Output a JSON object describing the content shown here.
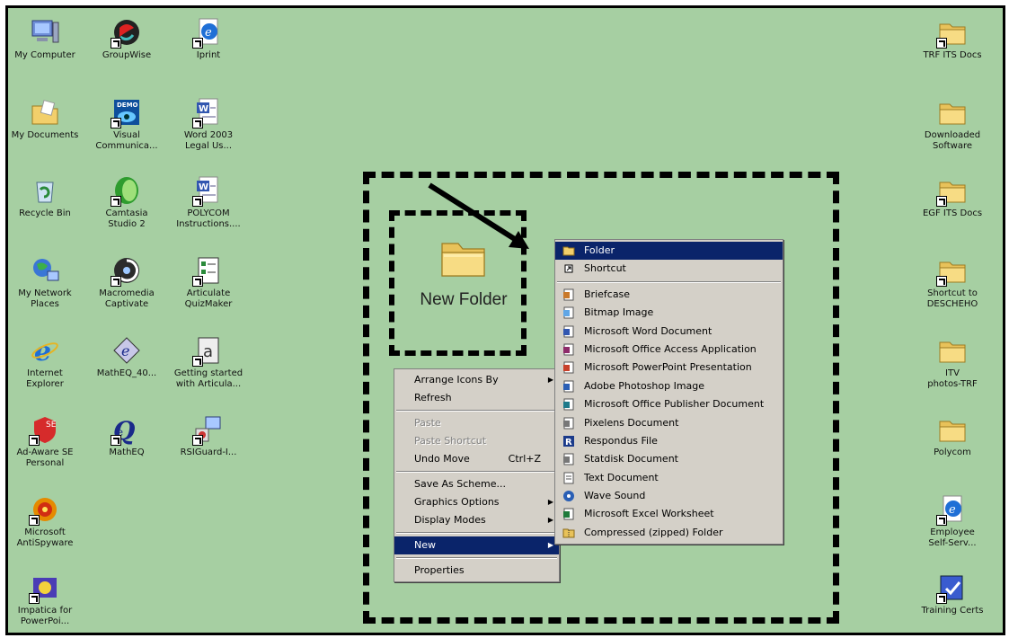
{
  "desktop_icons": {
    "col1": [
      {
        "label": "My Computer",
        "icon": "my-computer-icon"
      },
      {
        "label": "My Documents",
        "icon": "my-documents-icon"
      },
      {
        "label": "Recycle Bin",
        "icon": "recycle-bin-icon"
      },
      {
        "label": "My Network\nPlaces",
        "icon": "network-places-icon"
      },
      {
        "label": "Internet\nExplorer",
        "icon": "internet-explorer-icon"
      },
      {
        "label": "Ad-Aware SE\nPersonal",
        "icon": "ad-aware-icon"
      },
      {
        "label": "Microsoft\nAntiSpyware",
        "icon": "antispyware-icon"
      },
      {
        "label": "Impatica for\nPowerPoi...",
        "icon": "impatica-icon"
      }
    ],
    "col2": [
      {
        "label": "GroupWise",
        "icon": "groupwise-icon"
      },
      {
        "label": "Visual\nCommunica...",
        "icon": "visual-communicator-icon"
      },
      {
        "label": "Camtasia\nStudio 2",
        "icon": "camtasia-icon"
      },
      {
        "label": "Macromedia\nCaptivate",
        "icon": "captivate-icon"
      },
      {
        "label": "MathEQ_40...",
        "icon": "matheq-installer-icon"
      },
      {
        "label": "MathEQ",
        "icon": "matheq-icon"
      }
    ],
    "col3": [
      {
        "label": "Iprint",
        "icon": "iprint-icon"
      },
      {
        "label": "Word 2003\nLegal Us...",
        "icon": "word-document-icon"
      },
      {
        "label": "POLYCOM\nInstructions....",
        "icon": "word-document-icon"
      },
      {
        "label": "Articulate\nQuizMaker",
        "icon": "quizmaker-icon"
      },
      {
        "label": "Getting started\nwith Articula...",
        "icon": "getting-started-icon"
      },
      {
        "label": "RSIGuard-I...",
        "icon": "rsiguard-icon"
      }
    ],
    "right": [
      {
        "label": "TRF ITS Docs",
        "icon": "folder-shortcut-icon"
      },
      {
        "label": "Downloaded\nSoftware",
        "icon": "folder-icon"
      },
      {
        "label": "EGF ITS Docs",
        "icon": "folder-shortcut-icon"
      },
      {
        "label": "Shortcut to\nDESCHEHO",
        "icon": "folder-shortcut-icon"
      },
      {
        "label": "ITV\nphotos-TRF",
        "icon": "folder-icon"
      },
      {
        "label": "Polycom",
        "icon": "folder-icon"
      },
      {
        "label": "Employee\nSelf-Serv...",
        "icon": "web-shortcut-icon"
      },
      {
        "label": "Training Certs",
        "icon": "training-certs-icon"
      }
    ]
  },
  "new_folder": {
    "label": "New Folder"
  },
  "context_menu": {
    "items": [
      {
        "label": "Arrange Icons By",
        "submenu": true
      },
      {
        "label": "Refresh"
      },
      {
        "sep": true
      },
      {
        "label": "Paste",
        "disabled": true
      },
      {
        "label": "Paste Shortcut",
        "disabled": true
      },
      {
        "label": "Undo Move",
        "accel": "Ctrl+Z"
      },
      {
        "sep": true
      },
      {
        "label": "Save As Scheme..."
      },
      {
        "label": "Graphics Options",
        "submenu": true
      },
      {
        "label": "Display Modes",
        "submenu": true
      },
      {
        "sep": true
      },
      {
        "label": "New",
        "submenu": true,
        "selected": true
      },
      {
        "sep": true
      },
      {
        "label": "Properties"
      }
    ]
  },
  "new_submenu": {
    "items": [
      {
        "label": "Folder",
        "icon": "folder-icon",
        "selected": true
      },
      {
        "label": "Shortcut",
        "icon": "shortcut-icon"
      },
      {
        "sep": true
      },
      {
        "label": "Briefcase",
        "icon": "briefcase-icon"
      },
      {
        "label": "Bitmap Image",
        "icon": "bitmap-icon"
      },
      {
        "label": "Microsoft Word Document",
        "icon": "word-icon"
      },
      {
        "label": "Microsoft Office Access Application",
        "icon": "access-icon"
      },
      {
        "label": "Microsoft PowerPoint Presentation",
        "icon": "powerpoint-icon"
      },
      {
        "label": "Adobe Photoshop Image",
        "icon": "photoshop-icon"
      },
      {
        "label": "Microsoft Office Publisher Document",
        "icon": "publisher-icon"
      },
      {
        "label": "Pixelens Document",
        "icon": "pixelens-icon"
      },
      {
        "label": "Respondus File",
        "icon": "respondus-icon"
      },
      {
        "label": "Statdisk Document",
        "icon": "statdisk-icon"
      },
      {
        "label": "Text Document",
        "icon": "text-document-icon"
      },
      {
        "label": "Wave Sound",
        "icon": "wave-sound-icon"
      },
      {
        "label": "Microsoft Excel Worksheet",
        "icon": "excel-icon"
      },
      {
        "label": "Compressed (zipped) Folder",
        "icon": "zip-folder-icon"
      }
    ]
  },
  "colors": {
    "desktop": "#a6cfa2",
    "menu_bg": "#d4d0c8",
    "highlight": "#0a246a"
  }
}
